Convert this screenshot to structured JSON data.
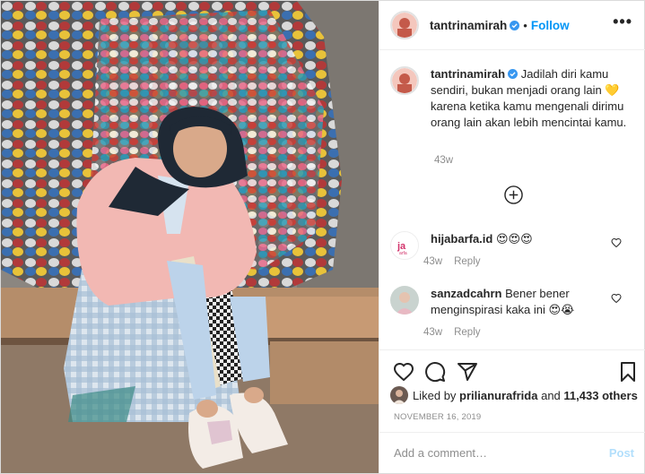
{
  "header": {
    "username": "tantrinamirah",
    "separator": "•",
    "follow_label": "Follow",
    "more_label": "•••"
  },
  "caption": {
    "username": "tantrinamirah",
    "text_part1": "Jadilah diri kamu sendiri, bukan menjadi orang lain",
    "emoji": "💛",
    "text_part2": "karena ketika kamu mengenali dirimu orang lain akan lebih mencintai kamu.",
    "time": "43w"
  },
  "comments": [
    {
      "username": "hijabarfa.id",
      "text": "😍😍😍",
      "time": "43w",
      "reply_label": "Reply"
    },
    {
      "username": "sanzadcahrn",
      "text": "Bener bener menginspirasi kaka ini 😍😭",
      "time": "43w",
      "reply_label": "Reply"
    }
  ],
  "likes": {
    "prefix": "Liked by",
    "first_liker": "prilianurafrida",
    "and_label": "and",
    "others": "11,433 others"
  },
  "date": "NOVEMBER 16, 2019",
  "add_comment": {
    "placeholder": "Add a comment…",
    "post_label": "Post"
  },
  "icons": {
    "like": "heart-icon",
    "comment": "comment-bubble-icon",
    "share": "paper-plane-icon",
    "save": "bookmark-icon",
    "load_more": "plus-circle-icon",
    "verified": "verified-badge-icon"
  },
  "colors": {
    "accent": "#0095f6",
    "post_disabled": "#b2dffc",
    "secondary_text": "#8e8e8e",
    "border": "#dbdbdb"
  }
}
